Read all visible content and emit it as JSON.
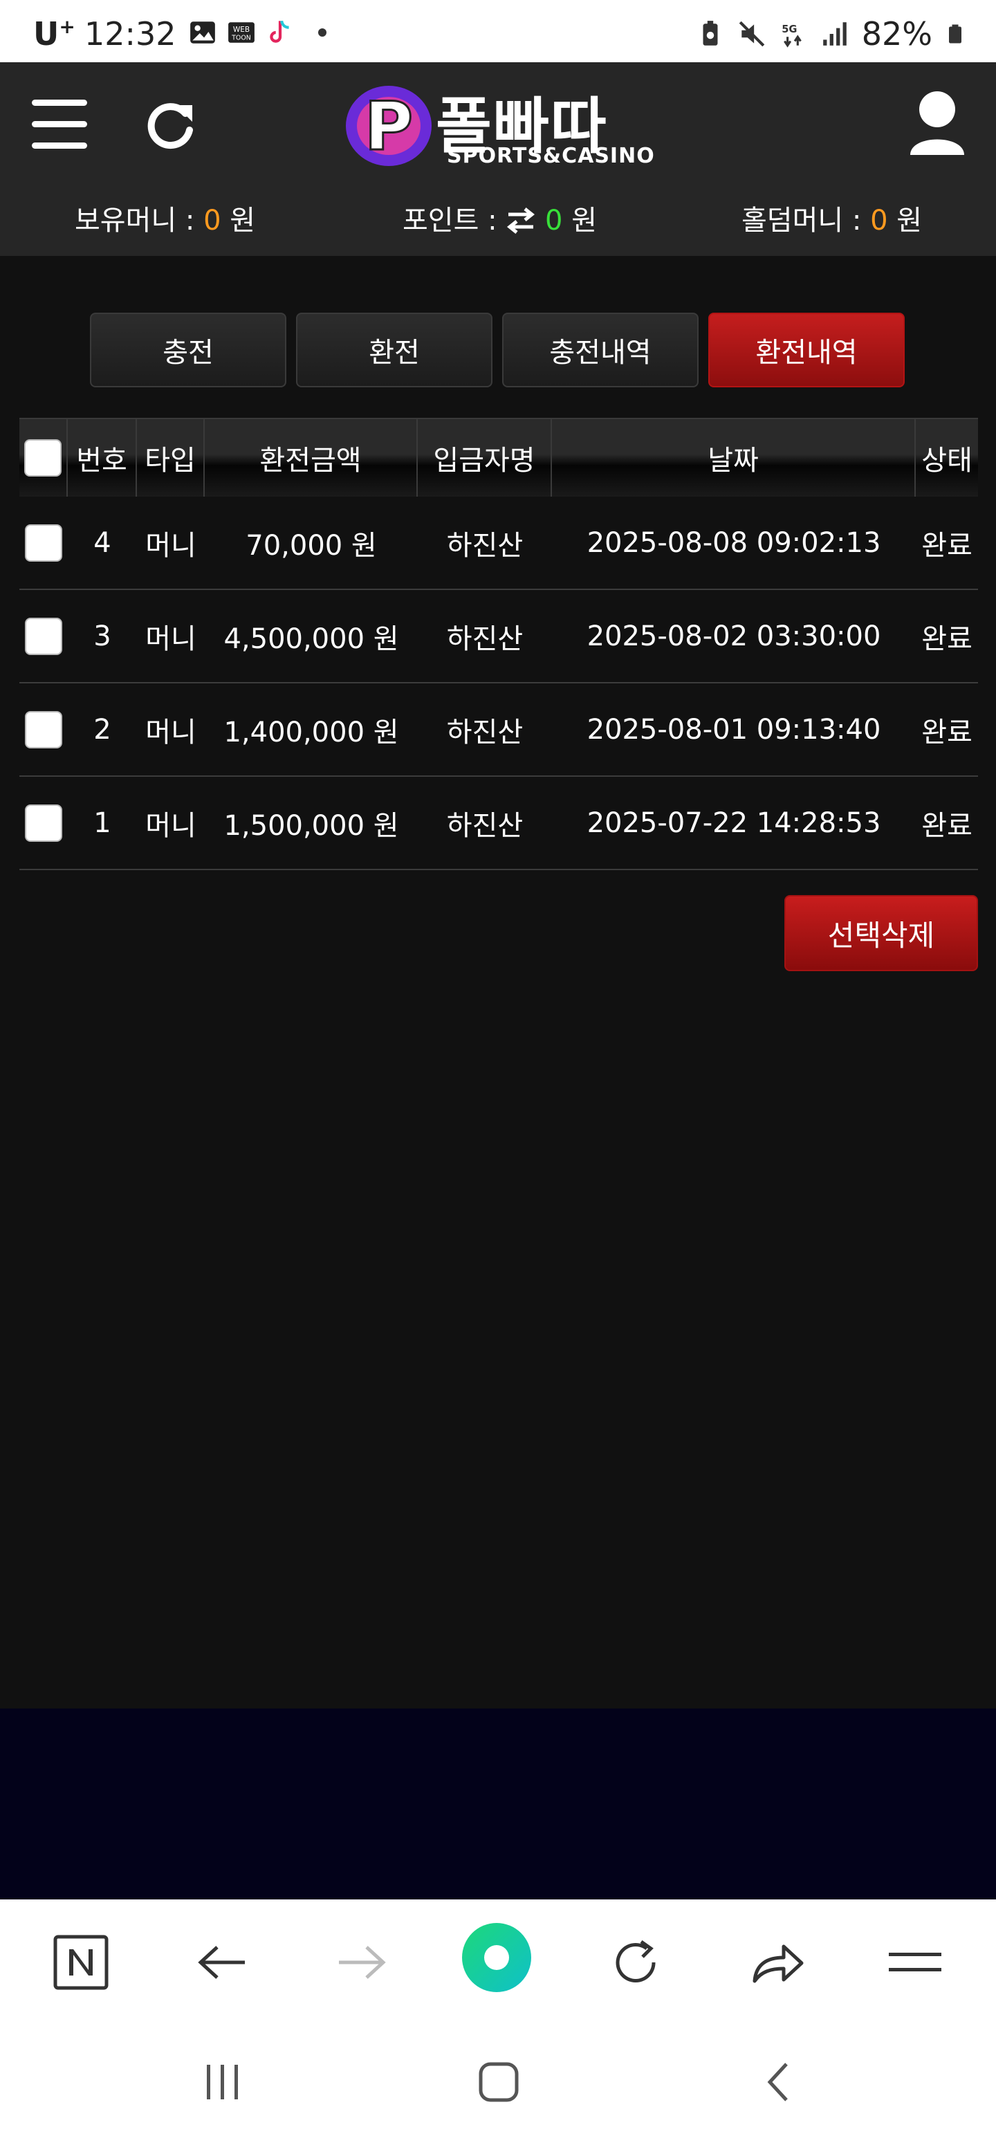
{
  "status_bar": {
    "carrier": "U",
    "carrier_sup": "+",
    "time": "12:32",
    "battery": "82%"
  },
  "header": {
    "logo_text": "폴빠따",
    "logo_sub": "SPORTS&CASINO",
    "money": {
      "balance_label": "보유머니 :",
      "balance_value": "0",
      "balance_unit": "원",
      "point_label": "포인트 :",
      "point_value": "0",
      "point_unit": "원",
      "holdem_label": "홀덤머니 :",
      "holdem_value": "0",
      "holdem_unit": "원"
    }
  },
  "tabs": [
    {
      "label": "충전"
    },
    {
      "label": "환전"
    },
    {
      "label": "충전내역"
    },
    {
      "label": "환전내역"
    }
  ],
  "table": {
    "headers": [
      "번호",
      "타입",
      "환전금액",
      "입금자명",
      "날짜",
      "상태"
    ],
    "rows": [
      {
        "no": "4",
        "type": "머니",
        "amount": "70,000 원",
        "name": "하진산",
        "date": "2025-08-08 09:02:13",
        "status": "완료"
      },
      {
        "no": "3",
        "type": "머니",
        "amount": "4,500,000 원",
        "name": "하진산",
        "date": "2025-08-02 03:30:00",
        "status": "완료"
      },
      {
        "no": "2",
        "type": "머니",
        "amount": "1,400,000 원",
        "name": "하진산",
        "date": "2025-08-01 09:13:40",
        "status": "완료"
      },
      {
        "no": "1",
        "type": "머니",
        "amount": "1,500,000 원",
        "name": "하진산",
        "date": "2025-07-22 14:28:53",
        "status": "완료"
      }
    ]
  },
  "delete_button": "선택삭제",
  "colors": {
    "accent_red": "#b31414",
    "money_orange": "#ff9a1f",
    "point_green": "#38e03a",
    "background": "#111111"
  },
  "icons": {
    "menu": "hamburger-icon",
    "refresh": "refresh-icon",
    "user": "user-icon",
    "point_swap": "swap-arrows-icon"
  }
}
